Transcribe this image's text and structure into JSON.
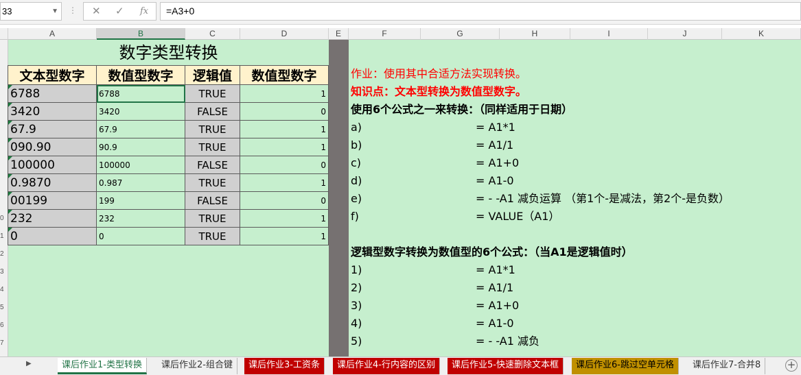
{
  "formula_bar": {
    "name_box": "33",
    "cancel_icon": "close-icon",
    "enter_icon": "check-icon",
    "fx_label": "fx",
    "formula": "=A3+0"
  },
  "columns": [
    "A",
    "B",
    "C",
    "D",
    "E",
    "F",
    "G",
    "H",
    "I",
    "J",
    "K"
  ],
  "selected_column": "B",
  "row_numbers": [
    "0",
    "1",
    "2",
    "3",
    "4",
    "5",
    "6",
    "7"
  ],
  "sheet_title": "数字类型转换",
  "table": {
    "headers": [
      "文本型数字",
      "数值型数字",
      "逻辑值",
      "数值型数字"
    ],
    "rows": [
      {
        "text": "6788",
        "num": "6788",
        "logic": "TRUE",
        "val": "1"
      },
      {
        "text": "3420",
        "num": "3420",
        "logic": "FALSE",
        "val": "0"
      },
      {
        "text": "67.9",
        "num": "67.9",
        "logic": "TRUE",
        "val": "1"
      },
      {
        "text": "090.90",
        "num": "90.9",
        "logic": "TRUE",
        "val": "1"
      },
      {
        "text": "100000",
        "num": "100000",
        "logic": "FALSE",
        "val": "0"
      },
      {
        "text": "0.9870",
        "num": "0.987",
        "logic": "TRUE",
        "val": "1"
      },
      {
        "text": "00199",
        "num": "199",
        "logic": "FALSE",
        "val": "0"
      },
      {
        "text": "232",
        "num": "232",
        "logic": "TRUE",
        "val": "1"
      },
      {
        "text": "0",
        "num": "0",
        "logic": "TRUE",
        "val": "1"
      }
    ]
  },
  "notes": {
    "homework": "作业：使用其中合适方法实现转换。",
    "knowledge": "知识点：文本型转换为数值型数字。",
    "intro1": "使用6个公式之一来转换：（同样适用于日期）",
    "list1": [
      {
        "label": "a)",
        "formula": "= A1*1"
      },
      {
        "label": "b)",
        "formula": "= A1/1"
      },
      {
        "label": "c)",
        "formula": "= A1+0"
      },
      {
        "label": "d)",
        "formula": "= A1-0"
      },
      {
        "label": "e)",
        "formula": "= - -A1 减负运算  （第1个-是减法，第2个-是负数）"
      },
      {
        "label": "f)",
        "formula": "= VALUE（A1）"
      }
    ],
    "intro2": "逻辑型数字转换为数值型的6个公式：（当A1是逻辑值时）",
    "list2": [
      {
        "label": "1)",
        "formula": "= A1*1"
      },
      {
        "label": "2)",
        "formula": "= A1/1"
      },
      {
        "label": "3)",
        "formula": "= A1+0"
      },
      {
        "label": "4)",
        "formula": "= A1-0"
      },
      {
        "label": "5)",
        "formula": "= - -A1 减负"
      }
    ]
  },
  "tabs": [
    {
      "label": "课后作业1-类型转换",
      "style": "active"
    },
    {
      "label": "课后作业2-组合键",
      "style": "plain"
    },
    {
      "label": "课后作业3-工资条",
      "style": "red"
    },
    {
      "label": "课后作业4-行内容的区别",
      "style": "red"
    },
    {
      "label": "课后作业5-快速删除文本框",
      "style": "red"
    },
    {
      "label": "课后作业6-跳过空单元格",
      "style": "gold"
    },
    {
      "label": "课后作业7-合并8",
      "style": "plain"
    }
  ],
  "colors": {
    "sheet_bg": "#c6efce",
    "header_bg": "#fff2cc",
    "gray_cell": "#d0d0d0",
    "divider_col": "#767171",
    "accent": "#217346",
    "red_text": "#ff0000",
    "red_tab": "#c00000",
    "gold_tab": "#c09000"
  }
}
